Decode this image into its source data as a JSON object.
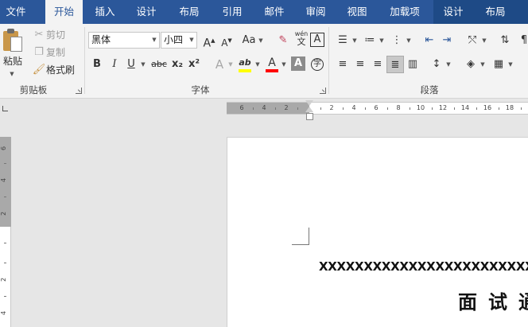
{
  "tabs": [
    "文件",
    "开始",
    "插入",
    "设计",
    "布局",
    "引用",
    "邮件",
    "审阅",
    "视图",
    "加载项",
    "设计",
    "布局"
  ],
  "active_tab": "开始",
  "clipboard": {
    "paste": "粘贴",
    "cut": "剪切",
    "copy": "复制",
    "format_painter": "格式刷",
    "group_label": "剪贴板"
  },
  "font": {
    "font_name": "黑体",
    "font_size": "小四",
    "change_case": "Aa",
    "phonetic_top": "wén",
    "phonetic_bottom": "文",
    "char_border": "A",
    "bold": "B",
    "italic": "I",
    "underline": "U",
    "strikethrough": "abc",
    "subscript": "x₂",
    "superscript": "x²",
    "text_effects": "A",
    "highlight": "ab",
    "font_color": "A",
    "char_shading": "A",
    "enclose": "字",
    "group_label": "字体",
    "highlight_color": "#ffff00",
    "font_color_value": "#ff0000"
  },
  "paragraph": {
    "group_label": "段落"
  },
  "ruler": {
    "horizontal_ticks": [
      "6",
      "4",
      "2",
      "2",
      "4",
      "6",
      "8",
      "10",
      "12",
      "14",
      "16",
      "18"
    ],
    "vertical_ticks": [
      "6",
      "4",
      "2",
      "2",
      "4"
    ]
  },
  "document": {
    "line1": "XXXXXXXXXXXXXXXXXXXXXXXXXXXXXXXXXXXXXXXXXX",
    "line2": "面试通知"
  },
  "colors": {
    "title_bar": "#2b579a",
    "ribbon": "#f3f3f3"
  }
}
